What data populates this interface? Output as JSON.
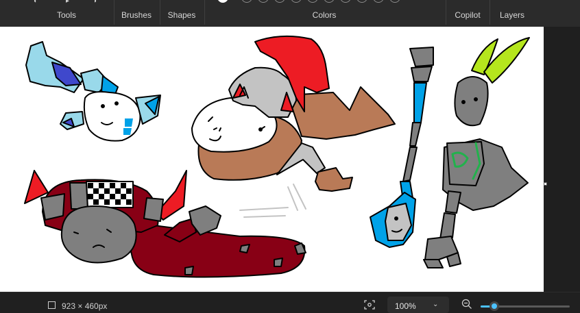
{
  "ribbon": {
    "groups": [
      "Tools",
      "Brushes",
      "Shapes",
      "Colors",
      "Copilot",
      "Layers"
    ],
    "color_swatches": [
      "#ffffff",
      "",
      "",
      "",
      "",
      "",
      "",
      "",
      "",
      "",
      ""
    ]
  },
  "status": {
    "canvas_size": "923 × 460px",
    "zoom": "100%",
    "zoom_slider_level": 0.15
  },
  "colors": {
    "accent": "#4cc2ff",
    "red": "#ed1c24",
    "dark_red": "#880015",
    "brown": "#b97a57",
    "light_blue": "#99d9ea",
    "blue": "#3f48cc",
    "sky_blue": "#00a2e8",
    "gray": "#7f7f7f",
    "light_gray": "#c3c3c3",
    "lime": "#b5e61d",
    "green": "#22b14c"
  },
  "icons": {
    "size": "canvas-size-icon",
    "fit": "fit-to-window-icon",
    "zoom_out": "zoom-out-icon",
    "chevron": "chevron-down-icon"
  }
}
